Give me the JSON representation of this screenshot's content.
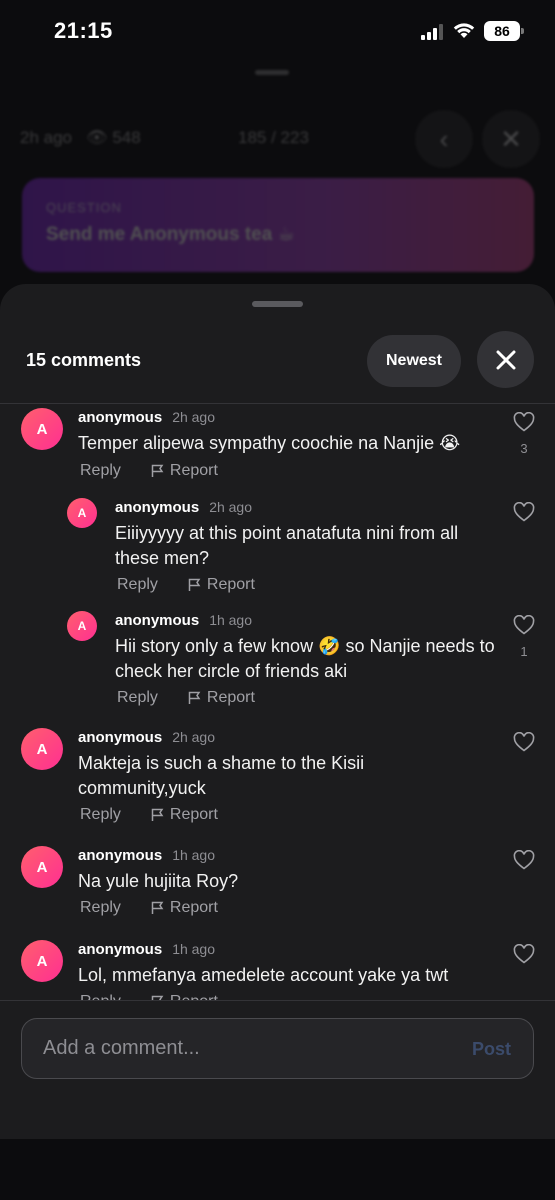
{
  "status_bar": {
    "time": "21:15",
    "battery": "86"
  },
  "background": {
    "meta_time": "2h ago",
    "meta_views": "548",
    "position": "185 / 223",
    "question_label": "QUESTION",
    "question_text": "Send me Anonymous tea ☕"
  },
  "sheet": {
    "title": "15 comments",
    "sort_label": "Newest"
  },
  "comments": [
    {
      "author": "anonymous",
      "ago": "2h ago",
      "text": "Temper alipewa sympathy coochie na Nanjie 😭",
      "likes": "3",
      "avatar": "A"
    },
    {
      "author": "anonymous",
      "ago": "2h ago",
      "text": "Eiiiyyyyy at this point anatafuta nini from all these men?",
      "likes": "",
      "avatar": "A"
    },
    {
      "author": "anonymous",
      "ago": "1h ago",
      "text": "Hii story only a few know 🤣 so Nanjie needs to check her circle of friends aki",
      "likes": "1",
      "avatar": "A"
    },
    {
      "author": "anonymous",
      "ago": "2h ago",
      "text": "Makteja is such a shame to the Kisii community,yuck",
      "likes": "",
      "avatar": "A"
    },
    {
      "author": "anonymous",
      "ago": "1h ago",
      "text": "Na yule hujiita Roy?",
      "likes": "",
      "avatar": "A"
    },
    {
      "author": "anonymous",
      "ago": "1h ago",
      "text": "Lol, mmefanya amedelete account yake ya twt",
      "likes": "",
      "avatar": "A"
    }
  ],
  "actions": {
    "reply_label": "Reply",
    "report_label": "Report"
  },
  "composer": {
    "placeholder": "Add a comment...",
    "post_label": "Post"
  },
  "colors": {
    "accent": "#ff2f92",
    "sheet": "#1c1c1e",
    "question_card": "#8a2be2"
  },
  "icons": [
    "signal-icon",
    "wifi-icon",
    "battery-icon",
    "eye-icon",
    "chevron-left-icon",
    "close-icon",
    "heart-icon",
    "flag-icon"
  ]
}
